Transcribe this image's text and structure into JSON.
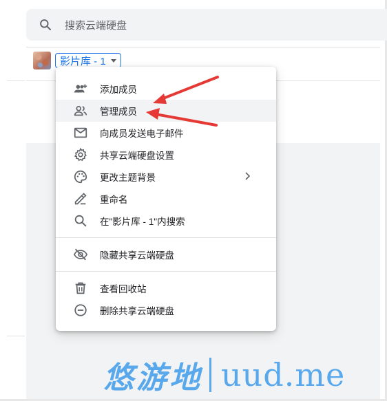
{
  "search": {
    "placeholder": "搜索云端硬盘",
    "icon": "search-icon"
  },
  "drive": {
    "name": "影片库 - 1",
    "dropdown_icon": "caret-down-icon"
  },
  "menu": {
    "groups": [
      [
        {
          "label": "添加成员",
          "icon": "person-add-icon"
        },
        {
          "label": "管理成员",
          "icon": "people-icon",
          "highlighted": true
        },
        {
          "label": "向成员发送电子邮件",
          "icon": "mail-icon"
        },
        {
          "label": "共享云端硬盘设置",
          "icon": "settings-gear-icon"
        },
        {
          "label": "更改主题背景",
          "icon": "palette-icon",
          "has_submenu": true
        },
        {
          "label": "重命名",
          "icon": "rename-pencil-icon"
        },
        {
          "label": "在\"影片库 - 1\"内搜索",
          "icon": "search-icon"
        }
      ],
      [
        {
          "label": "隐藏共享云端硬盘",
          "icon": "eye-off-icon"
        }
      ],
      [
        {
          "label": "查看回收站",
          "icon": "trash-icon"
        },
        {
          "label": "删除共享云端硬盘",
          "icon": "remove-circle-icon"
        }
      ]
    ]
  },
  "annotation": {
    "arrow_color": "#e53935"
  },
  "watermark": {
    "cn": "悠游地",
    "en": "uud.me"
  },
  "colors": {
    "accent": "#1a73e8",
    "menu_hover": "#f1f3f4",
    "watermark": "#5aa8ec"
  }
}
